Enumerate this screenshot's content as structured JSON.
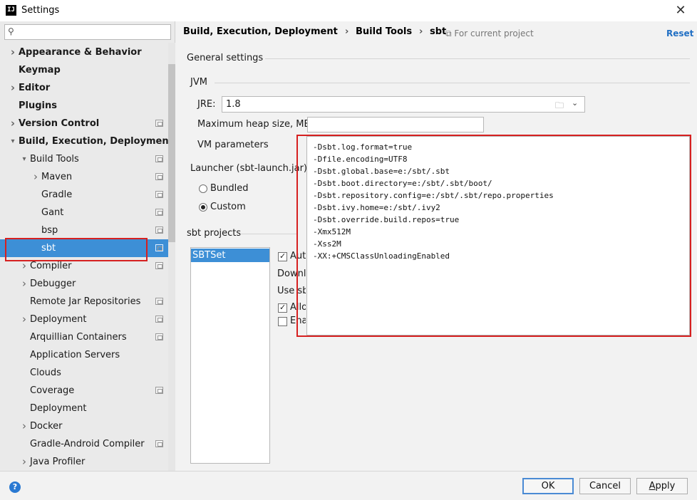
{
  "window": {
    "title": "Settings",
    "logo": "IJ"
  },
  "search": {
    "value": "",
    "placeholder": ""
  },
  "tree": [
    {
      "label": "Appearance & Behavior",
      "bold": true,
      "arrow": "right",
      "indent": 0,
      "project_icon": false
    },
    {
      "label": "Keymap",
      "bold": true,
      "arrow": "none",
      "indent": 0,
      "project_icon": false
    },
    {
      "label": "Editor",
      "bold": true,
      "arrow": "right",
      "indent": 0,
      "project_icon": false
    },
    {
      "label": "Plugins",
      "bold": true,
      "arrow": "none",
      "indent": 0,
      "project_icon": false
    },
    {
      "label": "Version Control",
      "bold": true,
      "arrow": "right",
      "indent": 0,
      "project_icon": true
    },
    {
      "label": "Build, Execution, Deployment",
      "bold": true,
      "arrow": "down",
      "indent": 0,
      "project_icon": false
    },
    {
      "label": "Build Tools",
      "bold": false,
      "arrow": "down",
      "indent": 1,
      "project_icon": true
    },
    {
      "label": "Maven",
      "bold": false,
      "arrow": "right",
      "indent": 2,
      "project_icon": true
    },
    {
      "label": "Gradle",
      "bold": false,
      "arrow": "none",
      "indent": 2,
      "project_icon": true
    },
    {
      "label": "Gant",
      "bold": false,
      "arrow": "none",
      "indent": 2,
      "project_icon": true
    },
    {
      "label": "bsp",
      "bold": false,
      "arrow": "none",
      "indent": 2,
      "project_icon": true
    },
    {
      "label": "sbt",
      "bold": false,
      "arrow": "none",
      "indent": 2,
      "project_icon": true,
      "selected": true
    },
    {
      "label": "Compiler",
      "bold": false,
      "arrow": "right",
      "indent": 1,
      "project_icon": true
    },
    {
      "label": "Debugger",
      "bold": false,
      "arrow": "right",
      "indent": 1,
      "project_icon": false
    },
    {
      "label": "Remote Jar Repositories",
      "bold": false,
      "arrow": "none",
      "indent": 1,
      "project_icon": true
    },
    {
      "label": "Deployment",
      "bold": false,
      "arrow": "right",
      "indent": 1,
      "project_icon": true
    },
    {
      "label": "Arquillian Containers",
      "bold": false,
      "arrow": "none",
      "indent": 1,
      "project_icon": true
    },
    {
      "label": "Application Servers",
      "bold": false,
      "arrow": "none",
      "indent": 1,
      "project_icon": false
    },
    {
      "label": "Clouds",
      "bold": false,
      "arrow": "none",
      "indent": 1,
      "project_icon": false
    },
    {
      "label": "Coverage",
      "bold": false,
      "arrow": "none",
      "indent": 1,
      "project_icon": true
    },
    {
      "label": "Deployment",
      "bold": false,
      "arrow": "none",
      "indent": 1,
      "project_icon": false
    },
    {
      "label": "Docker",
      "bold": false,
      "arrow": "right",
      "indent": 1,
      "project_icon": false
    },
    {
      "label": "Gradle-Android Compiler",
      "bold": false,
      "arrow": "none",
      "indent": 1,
      "project_icon": true
    },
    {
      "label": "Java Profiler",
      "bold": false,
      "arrow": "right",
      "indent": 1,
      "project_icon": false
    }
  ],
  "breadcrumb": [
    "Build, Execution, Deployment",
    "Build Tools",
    "sbt"
  ],
  "breadcrumb_separator": "›",
  "header": {
    "scope": "For current project",
    "reset": "Reset"
  },
  "general": {
    "title": "General settings",
    "jvm_title": "JVM",
    "jre_label": "JRE:",
    "jre_mnemonic": "J",
    "jre_label_rest": "RE:",
    "jre_value": "1.8",
    "heap_label": "Maximum heap size, MB",
    "heap_value": "",
    "vm_label": "VM parameters",
    "launcher_title": "Launcher (sbt-launch.jar)",
    "bundled_label": "Bundled",
    "custom_label": "Custom",
    "launcher_selected": "Custom"
  },
  "projects": {
    "title": "sbt projects",
    "items": [
      "SBTSet"
    ],
    "options": [
      {
        "text": "Auto",
        "checkbox": true,
        "checked": true
      },
      {
        "text": "Downlo",
        "checkbox": false,
        "checked": false
      },
      {
        "text": "Use sb",
        "checkbox": false,
        "checked": false
      },
      {
        "text": "Allo",
        "checkbox": true,
        "checked": true
      },
      {
        "text": "Ena",
        "checkbox": true,
        "checked": false
      }
    ]
  },
  "vm_parameters": [
    "-Dsbt.log.format=true",
    "-Dfile.encoding=UTF8",
    "-Dsbt.global.base=e:/sbt/.sbt",
    "-Dsbt.boot.directory=e:/sbt/.sbt/boot/",
    "-Dsbt.repository.config=e:/sbt/.sbt/repo.properties",
    "-Dsbt.ivy.home=e:/sbt/.ivy2",
    "-Dsbt.override.build.repos=true",
    "-Xmx512M",
    "-Xss2M",
    "-XX:+CMSClassUnloadingEnabled"
  ],
  "footer": {
    "help": "?",
    "ok": "OK",
    "cancel": "Cancel",
    "apply": "Apply",
    "apply_mnemonic": "A",
    "apply_rest": "pply"
  },
  "colors": {
    "selection": "#3d8fd6",
    "highlight_box": "#d62020",
    "link": "#2270c4"
  }
}
